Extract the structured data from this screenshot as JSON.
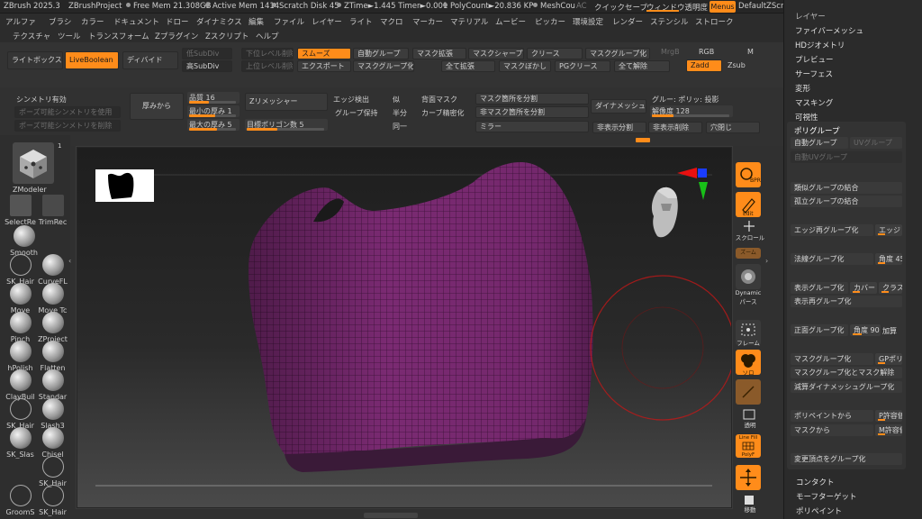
{
  "titlebar": {
    "app": "ZBrush 2025.3",
    "project": "ZBrushProject",
    "free_mem": "Free Mem 21.308GB",
    "active_mem": "Active Mem 1414",
    "scratch": "Scratch Disk 45",
    "ztime": "ZTime►1.445 Timer►0.001",
    "polycount": "PolyCount►20.836 KP",
    "meshcount": "MeshCou",
    "ac": "AC",
    "quicksave": "クイックセーブ",
    "transparency": "ウィンドウ透明度",
    "menus": "Menus",
    "script": "DefaultZScript"
  },
  "menubar": {
    "row1": [
      "アルファ",
      "ブラシ",
      "カラー",
      "ドキュメント",
      "ドロー",
      "ダイナミクス",
      "編集",
      "ファイル",
      "レイヤー",
      "ライト",
      "マクロ",
      "マーカー",
      "マテリアル",
      "ムービー",
      "ピッカー",
      "環境設定",
      "レンダー",
      "ステンシル",
      "ストローク"
    ],
    "row2": [
      "テクスチャ",
      "ツール",
      "トランスフォーム",
      "Zプラグイン",
      "Zスクリプト",
      "ヘルプ"
    ]
  },
  "shelf": {
    "lightbox": "ライトボックス",
    "liveboolean": "LiveBoolean",
    "divide": "ディバイド",
    "low_subdiv": "低SubDiv",
    "high_subdiv": "高SubDiv",
    "lower_level_delete": "下位レベル削除",
    "upper_level_delete": "上位レベル削除",
    "smooth": "スムーズ",
    "export": "エクスポート",
    "auto_group": "自動グループ",
    "mask_group": "マスクグループ化",
    "mask_expand": "マスク拡張",
    "expand_all": "全て拡張",
    "mask_sharpen": "マスクシャープ",
    "mask_blur": "マスクぼかし",
    "crease": "クリース",
    "pg_crease": "PGクリース",
    "mask_group2": "マスクグループ化",
    "release_all": "全て解除",
    "mrgb": "MrgB",
    "rgb": "RGB",
    "m": "M",
    "zadd": "Zadd",
    "zsub": "Zsub"
  },
  "subtool": {
    "symmetry": "シンメトリ有効",
    "pose_symmetry_use": "ポーズ可能シンメトリを使用",
    "pose_symmetry_delete": "ポーズ可能シンメトリを削除",
    "thickness_from": "厚みから",
    "quality_label": "品質 16",
    "quality": 16,
    "min_thickness_label": "最小の厚み 1",
    "min_thickness": 1,
    "max_thickness_label": "最大の厚み 5",
    "max_thickness": 5,
    "zremesher": "Zリメッシャー",
    "target_poly_label": "目標ポリゴン数 5",
    "target_poly": 5,
    "edge_detect": "エッジ検出",
    "group_keep": "グループ保持",
    "fold": "似",
    "half": "半分",
    "same": "同一",
    "back_mask": "背面マスク",
    "curve_refine": "カーブ精密化",
    "split_mask": "マスク箇所を分割",
    "split_unmask": "非マスク箇所を分割",
    "mirror": "ミラー",
    "dynamesh": "ダイナメッシュ",
    "groups_polish": "グルー: ポリッ: 投影",
    "resolution_label": "解像度 128",
    "resolution": 128,
    "hide_split": "非表示分割",
    "hide_delete": "非表示削除",
    "hole_close": "穴閉じ"
  },
  "tools": {
    "zmodeler": "ZModeler",
    "zmodeler_count": "1",
    "brushes": [
      {
        "name": "SelectRe",
        "name2": "TrimRec"
      },
      {
        "name": "Smooth",
        "name2": ""
      },
      {
        "name": "SK_Hair",
        "name2": "CurveFL"
      },
      {
        "name": "Move",
        "name2": "Move Tc"
      },
      {
        "name": "Pinch",
        "name2": "ZProject"
      },
      {
        "name": "hPolish",
        "name2": "Flatten"
      },
      {
        "name": "ClayBuil",
        "name2": "Standar"
      },
      {
        "name": "SK_Hair",
        "name2": "Slash3"
      },
      {
        "name": "SK_Slas",
        "name2": "Chisel"
      },
      {
        "name": "",
        "name2": "SK_Hair"
      },
      {
        "name": "GroomS",
        "name2": "SK_Hair"
      }
    ]
  },
  "right_shelf": {
    "bpr": "BPR",
    "edit": "Edit",
    "scroll": "スクロール",
    "zoom": "ズーム",
    "dynamic_persp": "Dynamic パース",
    "frame": "フレーム",
    "solo": "ソロ",
    "transp": "透明",
    "line_fill": "Line Fill",
    "polyf": "PolyF",
    "move": "移動"
  },
  "palette": {
    "items_top": [
      "レイヤー",
      "ファイバーメッシュ",
      "HDジオメトリ",
      "プレビュー",
      "サーフェス",
      "変形",
      "マスキング",
      "可視性",
      "ポリグループ"
    ],
    "polygroup": {
      "auto_group": "自動グループ",
      "uv_group": "UVグループ",
      "auto_uv_group": "自動UVグループ",
      "similar_merge": "類似グループの結合",
      "isolated_merge": "孤立グループの結合",
      "edge_regroup": "エッジ再グループ化",
      "edge_short": "エッジ",
      "normal_group": "法線グループ化",
      "angle_label": "角度 45",
      "angle": 45,
      "visible_group": "表示グループ化",
      "cover": "カバー",
      "cluster": "クラスタ",
      "visible_regroup": "表示再グループ化",
      "front_group": "正面グループ化",
      "angle2_label": "角度 90",
      "angle2": 90,
      "add": "加算",
      "mask_group": "マスクグループ化",
      "gp": "GPポリ",
      "mask_group_clear": "マスクグループ化とマスク解除",
      "reduce_dynamesh": "減算ダイナメッシュグループ化",
      "from_polypaint": "ポリペイントから",
      "p_tol": "P許容値",
      "from_mask": "マスクから",
      "m_tol": "M許容値",
      "convert_vertex": "変更頂点をグループ化"
    },
    "items_bottom": [
      "コンタクト",
      "モーフターゲット",
      "ポリペイント"
    ]
  },
  "colors": {
    "accent": "#ff8c1a",
    "mesh": "#7a2a72",
    "background": "#2b2b2b"
  }
}
